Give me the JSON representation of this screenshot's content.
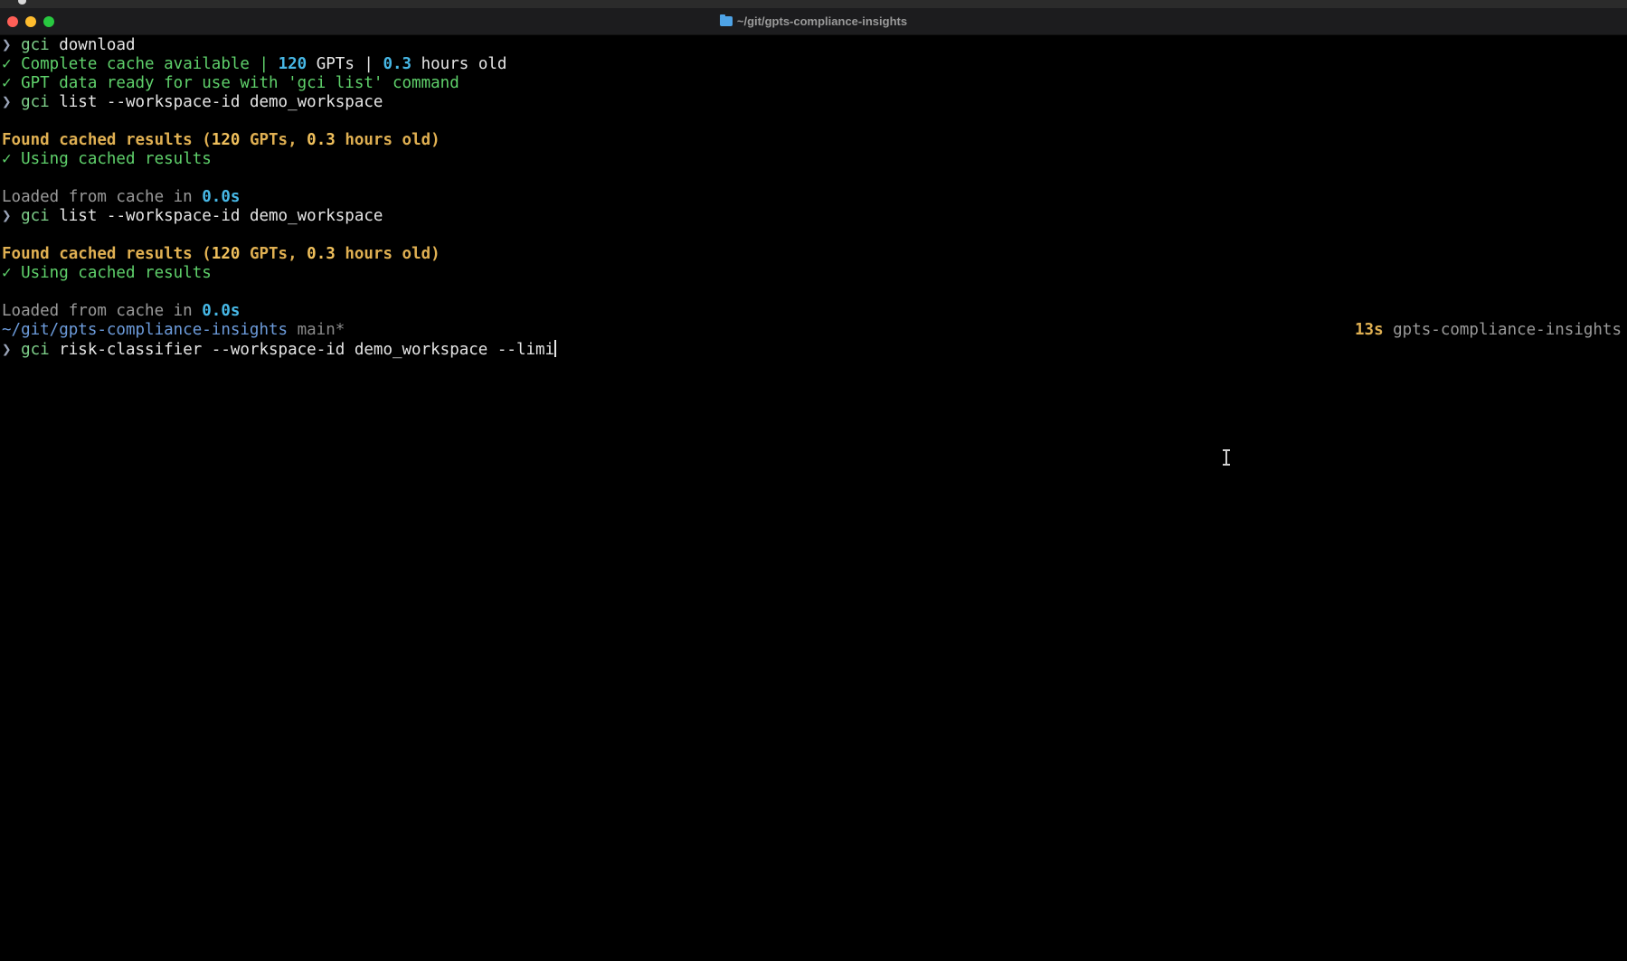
{
  "window": {
    "title": "~/git/gpts-compliance-insights"
  },
  "terminal": {
    "lines": [
      {
        "prompt": "❯ ",
        "cmd": "gci",
        "args": " download"
      },
      {
        "check": "✓ ",
        "text_a": "Complete cache available | ",
        "n1": "120",
        "text_b": " GPTs | ",
        "n2": "0.3",
        "text_c": " hours old"
      },
      {
        "check": "✓ ",
        "text": "GPT data ready for use with 'gci list' command"
      },
      {
        "prompt": "❯ ",
        "cmd": "gci",
        "args": " list --workspace-id demo_workspace"
      },
      {
        "found_a": "Found cached results (",
        "n1": "120",
        "found_b": " GPTs, ",
        "n2": "0.3",
        "found_c": " hours old)"
      },
      {
        "check": "✓ ",
        "text": "Using cached results"
      },
      {
        "loaded": "Loaded from cache in ",
        "time": "0.0s"
      },
      {
        "prompt": "❯ ",
        "cmd": "gci",
        "args": " list --workspace-id demo_workspace"
      },
      {
        "found_a": "Found cached results (",
        "n1": "120",
        "found_b": " GPTs, ",
        "n2": "0.3",
        "found_c": " hours old)"
      },
      {
        "check": "✓ ",
        "text": "Using cached results"
      },
      {
        "loaded": "Loaded from cache in ",
        "time": "0.0s"
      },
      {
        "path": "~/git/gpts-compliance-insights",
        "branch": " main*",
        "duration": "13s",
        "right_dir": " gpts-compliance-insights"
      },
      {
        "prompt": "❯ ",
        "cmd": "gci",
        "args": " risk-classifier --workspace-id demo_workspace --limi"
      }
    ]
  }
}
